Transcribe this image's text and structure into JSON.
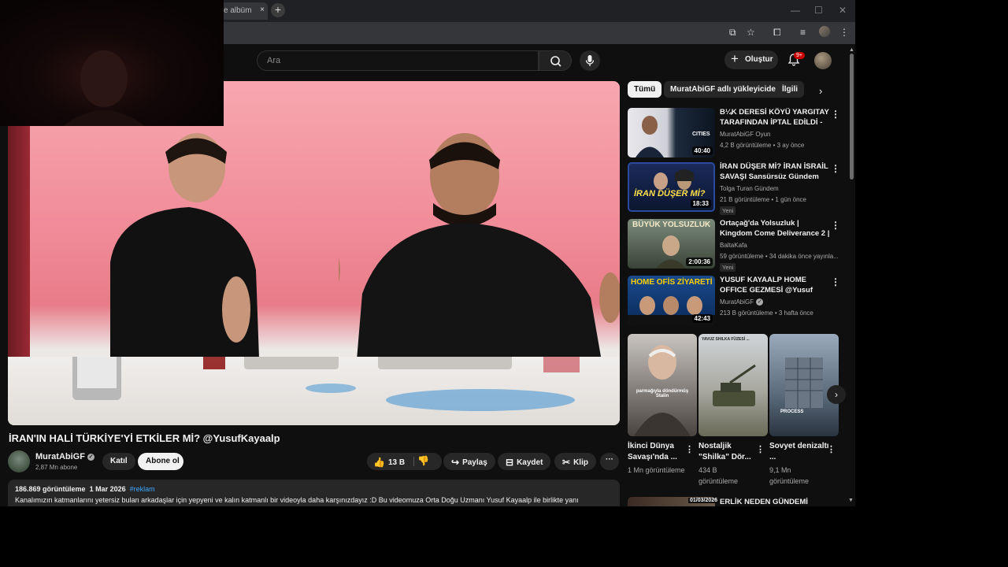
{
  "browser": {
    "tab_title": "e albüm",
    "tab_close": "×",
    "new_tab": "+"
  },
  "header": {
    "search_placeholder": "Ara",
    "create_label": "Oluştur",
    "notification_count": "9+"
  },
  "video": {
    "title": "İRAN'IN HALİ TÜRKİYE'Yİ ETKİLER Mİ? @YusufKayaalp",
    "channel_name": "MuratAbiGF",
    "subscribers": "2,87 Mn abone",
    "join_label": "Katıl",
    "subscribe_label": "Abone ol",
    "likes": "13 B",
    "share_label": "Paylaş",
    "save_label": "Kaydet",
    "clip_label": "Klip",
    "more_label": "···"
  },
  "description": {
    "views": "186.869 görüntüleme",
    "date": "1 Mar 2026",
    "tag": "#reklam",
    "text": "Kanalımızın katmanlarını yetersiz bulan arkadaşlar için yepyeni ve kalın katmanlı bir videoyla daha karşınızdayız :D Bu videomuza Orta Doğu Uzmanı Yusuf Kayaalp ile birlikte yanı"
  },
  "chips": [
    "Tümü",
    "MuratAbiGF adlı yükleyiciden",
    "İlgili"
  ],
  "recommendations": [
    {
      "title": "B¼K DERESİ KÖYÜ YARGITAY TARAFINDAN İPTAL EDİLDİ - ...",
      "channel": "MuratAbiGF Oyun",
      "meta": "4,2 B görüntüleme • 3 ay önce",
      "duration": "40:40",
      "badge": ""
    },
    {
      "title": "İRAN DÜŞER Mİ? İRAN İSRAİL SAVAŞI Sansürsüz Gündem",
      "channel": "Tolga Turan Gündem",
      "meta": "21 B görüntüleme • 1 gün önce",
      "duration": "18:33",
      "badge": "Yeni"
    },
    {
      "title": "Ortaçağ'da Yolsuzluk | Kingdom Come Deliverance 2 | Türkçe | ...",
      "channel": "BaltaKafa",
      "meta": "59 görüntüleme • 34 dakika önce yayınla...",
      "duration": "2:00:36",
      "badge": "Yeni"
    },
    {
      "title": "YUSUF KAYAALP HOME OFFICE GEZMESİ @Yusuf Kayaalp",
      "channel": "MuratAbiGF",
      "meta": "213 B görüntüleme • 3 hafta önce",
      "duration": "42:43",
      "badge": ""
    }
  ],
  "thumb_text": {
    "cities": "CITIES",
    "iran": "İRAN DÜŞER Mİ?",
    "yolsuzluk": "BÜYÜK YOLSUZLUK",
    "home_ofis": "HOME OFİS ZİYARETİ",
    "short1_caption": "parmağıyla döndürmüş Stalin",
    "short2_caption": "YAVUZ SHILKA FÜZESİ ...",
    "short3_caption": "PROCESS"
  },
  "shorts": [
    {
      "title": "İkinci Dünya Savaşı'nda ...",
      "views": "1 Mn görüntüleme"
    },
    {
      "title": "Nostaljik \"Shilka\" Dör...",
      "views": "434 B görüntüleme"
    },
    {
      "title": "Sovyet denizaltı ...",
      "views": "9,1 Mn görüntüleme"
    }
  ],
  "next_rec": {
    "title": "ERLİK NEDEN GÜNDEMİ",
    "date": "01/03/2026"
  },
  "colors": {
    "accent_link": "#3ea6ff",
    "notification_red": "#cc0000",
    "background": "#0f0f0f"
  },
  "icons": [
    "search-icon",
    "mic-icon",
    "bell-icon",
    "like-icon",
    "dislike-icon",
    "share-icon",
    "save-icon",
    "scissors-icon",
    "more-vert-icon",
    "chevron-right-icon"
  ]
}
